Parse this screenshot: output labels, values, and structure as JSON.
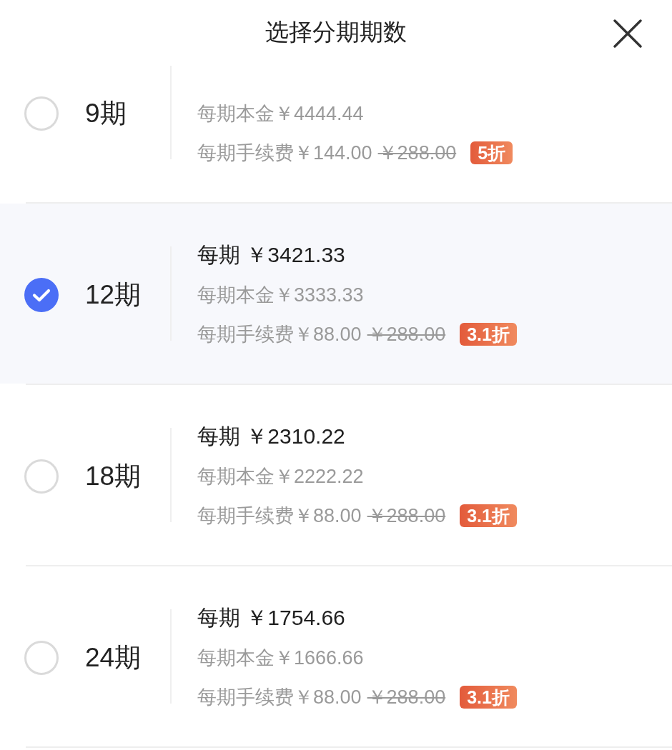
{
  "header": {
    "title": "选择分期期数"
  },
  "plans": [
    {
      "term": "9期",
      "selected": false,
      "principal": "每期本金￥4444.44",
      "fee": "每期手续费￥144.00",
      "original_fee": "￥288.00",
      "discount": "5折"
    },
    {
      "term": "12期",
      "selected": true,
      "per_period": "每期 ￥3421.33",
      "principal": "每期本金￥3333.33",
      "fee": "每期手续费￥88.00",
      "original_fee": "￥288.00",
      "discount": "3.1折"
    },
    {
      "term": "18期",
      "selected": false,
      "per_period": "每期 ￥2310.22",
      "principal": "每期本金￥2222.22",
      "fee": "每期手续费￥88.00",
      "original_fee": "￥288.00",
      "discount": "3.1折"
    },
    {
      "term": "24期",
      "selected": false,
      "per_period": "每期 ￥1754.66",
      "principal": "每期本金￥1666.66",
      "fee": "每期手续费￥88.00",
      "original_fee": "￥288.00",
      "discount": "3.1折"
    }
  ]
}
